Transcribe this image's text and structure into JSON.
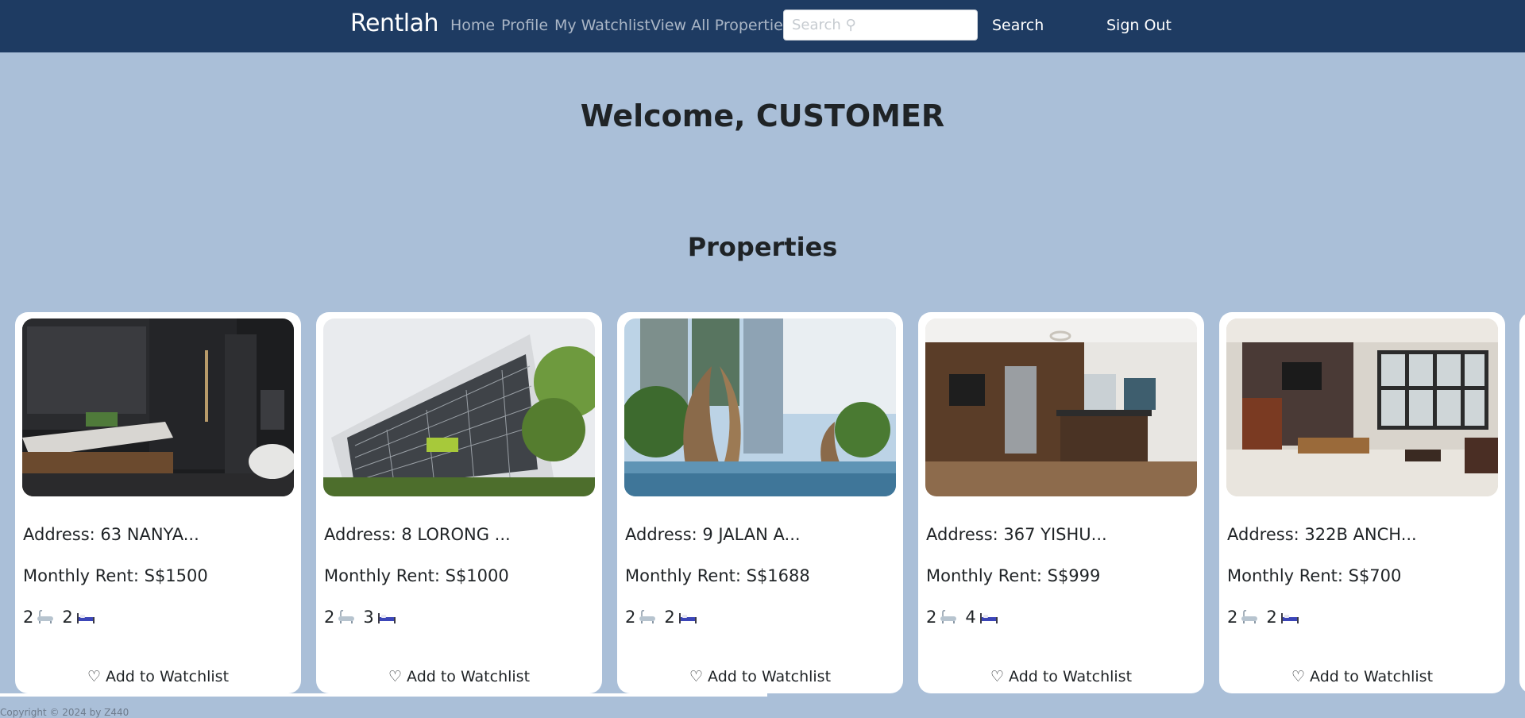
{
  "nav": {
    "brand": "Rentlah",
    "links": [
      "Home",
      "Profile",
      "My Watchlist",
      "View All Properties"
    ],
    "search_placeholder": "Search ⚲",
    "search_label": "Search",
    "signout_label": "Sign Out"
  },
  "welcome": "Welcome, CUSTOMER",
  "section_title": "Properties",
  "cards": [
    {
      "address": "Address: 63 NANYA...",
      "rent": "Monthly Rent: S$1500",
      "baths": "2",
      "beds": "2",
      "watch_label": "♡ Add to Watchlist",
      "image_alt": "bathroom"
    },
    {
      "address": "Address: 8 LORONG ...",
      "rent": "Monthly Rent: S$1000",
      "baths": "2",
      "beds": "3",
      "watch_label": "♡ Add to Watchlist",
      "image_alt": "building exterior"
    },
    {
      "address": "Address: 9 JALAN A...",
      "rent": "Monthly Rent: S$1688",
      "baths": "2",
      "beds": "2",
      "watch_label": "♡ Add to Watchlist",
      "image_alt": "pool and towers"
    },
    {
      "address": "Address: 367 YISHU...",
      "rent": "Monthly Rent: S$999",
      "baths": "2",
      "beds": "4",
      "watch_label": "♡ Add to Watchlist",
      "image_alt": "kitchen"
    },
    {
      "address": "Address: 322B ANCH...",
      "rent": "Monthly Rent: S$700",
      "baths": "2",
      "beds": "2",
      "watch_label": "♡ Add to Watchlist",
      "image_alt": "living room"
    }
  ],
  "footer": "Copyright © 2024 by Z440",
  "colors": {
    "navbar": "#1e3b62",
    "background": "#aabfd8",
    "card": "#ffffff",
    "nav_link": "#aab6c6"
  }
}
